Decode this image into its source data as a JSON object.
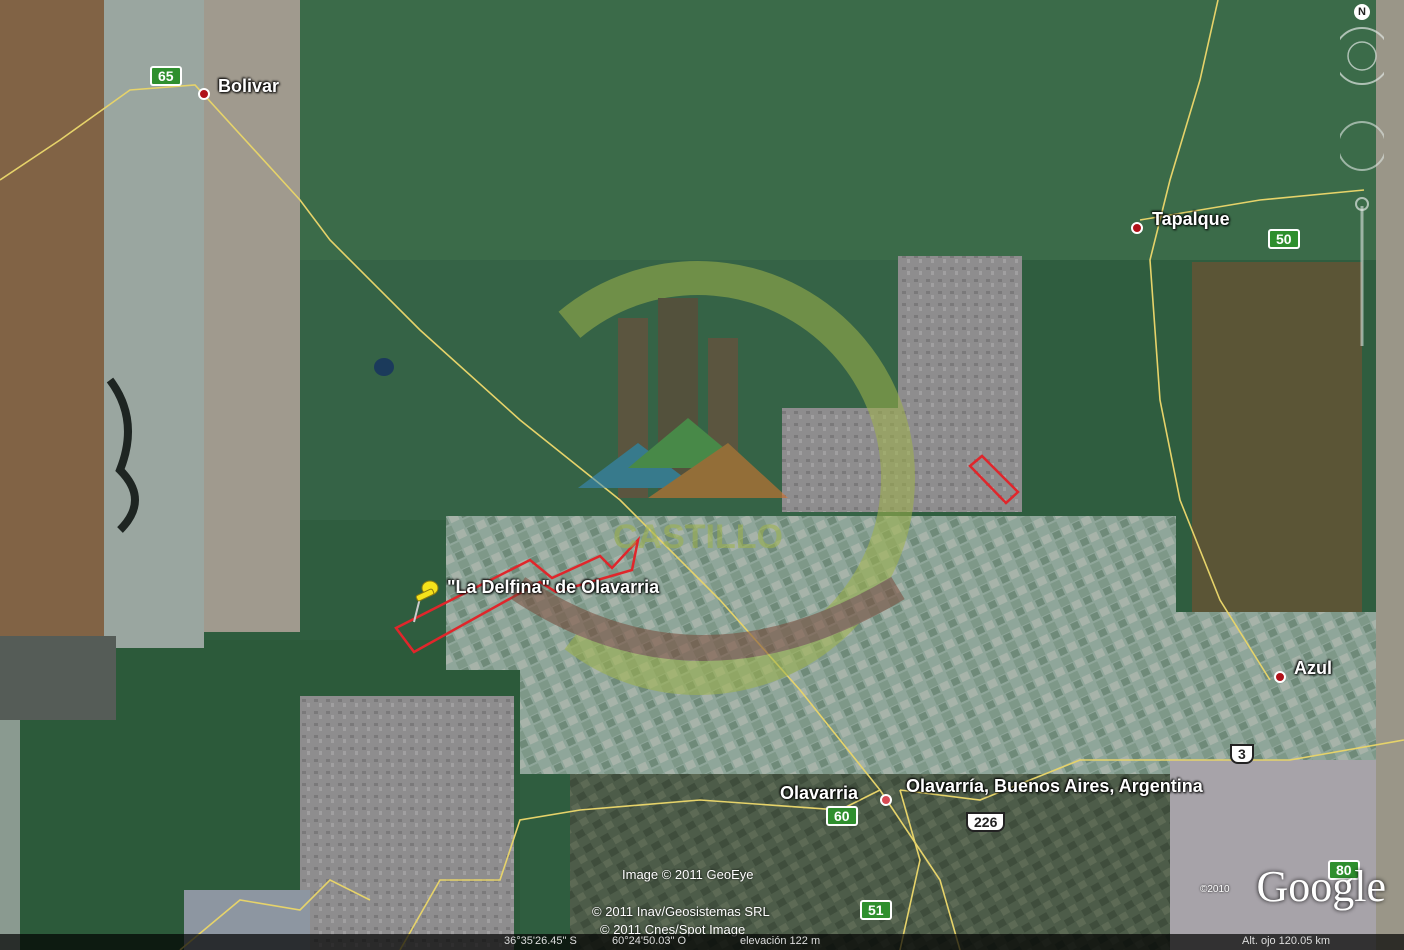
{
  "places": {
    "bolivar": "Bolivar",
    "tapalque": "Tapalque",
    "azul": "Azul",
    "olavarria": "Olavarria",
    "olavarria_full": "Olavarría, Buenos Aires, Argentina",
    "placemark": "\"La Delfina\" de Olavarria"
  },
  "routes": {
    "r65": "65",
    "r50": "50",
    "r3": "3",
    "r60": "60",
    "r226": "226",
    "r51": "51",
    "r80": "80"
  },
  "credits": {
    "geoeye": "Image © 2011 GeoEye",
    "inav": "© 2011 Inav/Geosistemas SRL",
    "cnes": "© 2011 Cnes/Spot Image",
    "copyright_year": "©2010"
  },
  "branding": {
    "google": "Google",
    "watermark_text": "CASTILLO"
  },
  "navigation": {
    "north": "N"
  },
  "status_bar": {
    "coords": "36°35'26.45\" S",
    "lon": "60°24'50.03\" O",
    "elev": "elevación  122 m",
    "alt": "Alt. ojo  120.05 km"
  },
  "colors": {
    "forest": "#2f5a3e",
    "road": "#e6d36a",
    "parcel": "#e0262b",
    "pin": "#f5e21b"
  }
}
